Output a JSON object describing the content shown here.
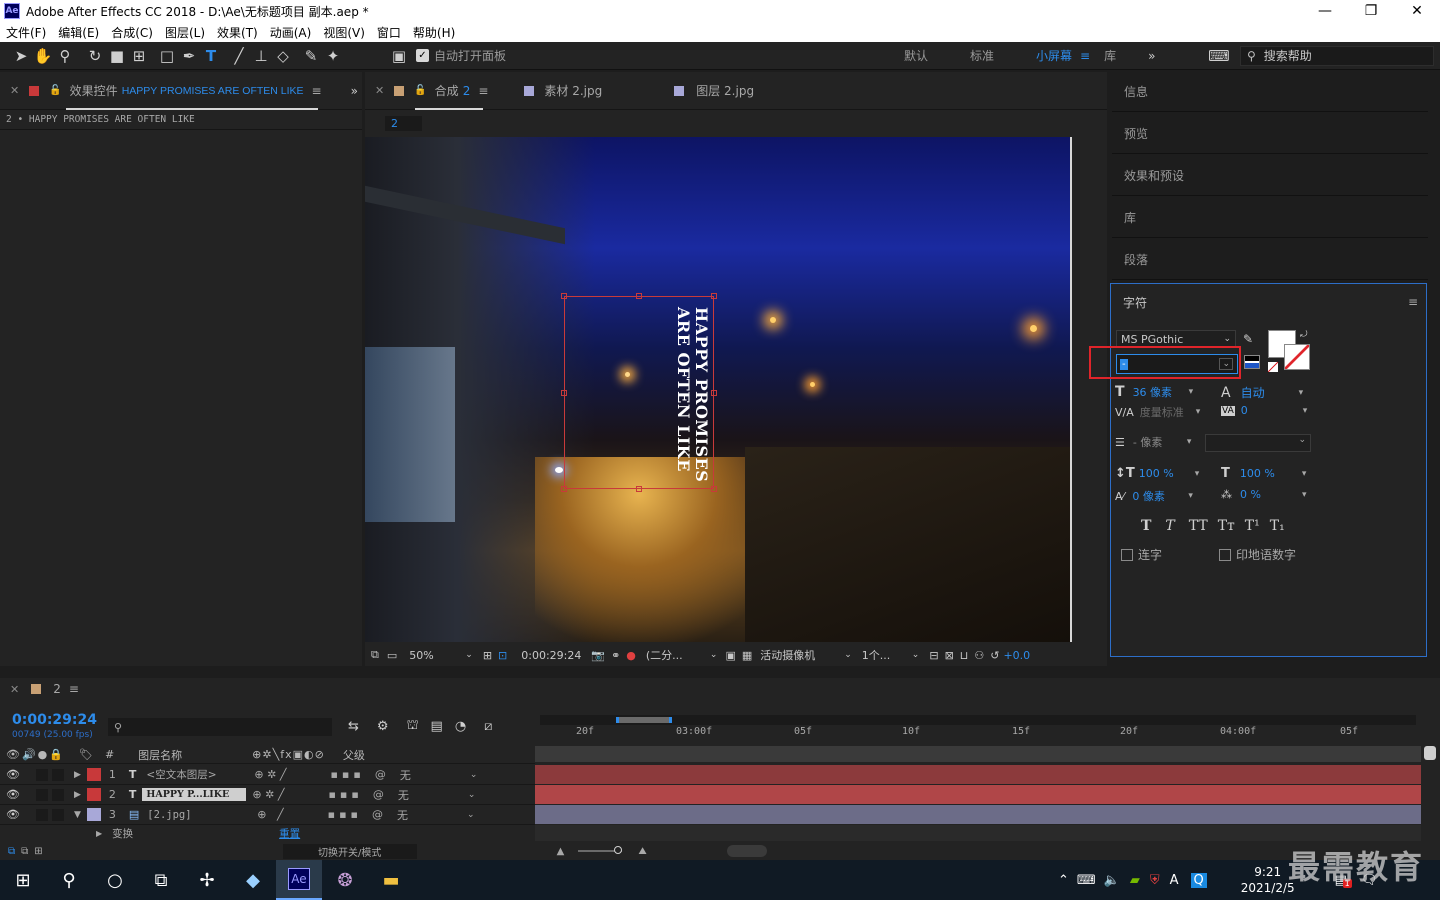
{
  "app": {
    "title": "Adobe After Effects CC 2018 - D:\\Ae\\无标题项目 副本.aep *",
    "logo": "Ae"
  },
  "window_controls": {
    "minimize": "—",
    "maximize": "❐",
    "close": "✕"
  },
  "menu": [
    "文件(F)",
    "编辑(E)",
    "合成(C)",
    "图层(L)",
    "效果(T)",
    "动画(A)",
    "视图(V)",
    "窗口",
    "帮助(H)"
  ],
  "toolbar": {
    "auto_open_label": "自动打开面板",
    "workspaces": [
      "默认",
      "标准",
      "小屏幕",
      "库"
    ],
    "active_workspace": "小屏幕",
    "search_placeholder": "搜索帮助",
    "more": "»"
  },
  "effects_panel": {
    "tab_label": "效果控件",
    "tab_layer": "HAPPY PROMISES ARE OFTEN LIKE",
    "subtitle": "2 • HAPPY PROMISES ARE OFTEN LIKE"
  },
  "comp_panel": {
    "tabs": [
      {
        "label": "合成",
        "extra": "2"
      },
      {
        "label": "素材 2.jpg"
      },
      {
        "label": "图层 2.jpg"
      }
    ],
    "breadcrumb": "2",
    "text_line1": "HAPPY PROMISES",
    "text_line2": "ARE OFTEN LIKE"
  },
  "viewer_bar": {
    "zoom": "50%",
    "timecode": "0:00:29:24",
    "resolution": "(二分...",
    "camera": "活动摄像机",
    "views": "1个...",
    "offset": "+0.0"
  },
  "right_panels": [
    "信息",
    "预览",
    "效果和预设",
    "库",
    "段落"
  ],
  "character_panel": {
    "title": "字符",
    "font": "MS PGothic",
    "style_value": "-",
    "size": "36 像素",
    "leading": "自动",
    "kerning": "度量标准",
    "tracking": "0",
    "stroke": "- 像素",
    "vscale": "100 %",
    "hscale": "100 %",
    "baseline": "0 像素",
    "tsume": "0 %",
    "styles": [
      "T",
      "T",
      "TT",
      "Tт",
      "T¹",
      "T₁"
    ],
    "ligatures": "连字",
    "hindi_digits": "印地语数字"
  },
  "timeline": {
    "tab_label": "2",
    "timecode": "0:00:29:24",
    "fps": "00749 (25.00 fps)",
    "col_layer_name": "图层名称",
    "col_parent": "父级",
    "col_num": "#",
    "layers": [
      {
        "num": "1",
        "name": "<空文本图层>",
        "parent": "无"
      },
      {
        "num": "2",
        "name": "HAPPY P...LIKE",
        "parent": "无"
      },
      {
        "num": "3",
        "name": "[2.jpg]",
        "parent": "无"
      }
    ],
    "transform_label": "变换",
    "reset_label": "重置",
    "switch_label": "切换开关/模式",
    "ruler": [
      "20f",
      "03:00f",
      "05f",
      "10f",
      "15f",
      "20f",
      "04:00f",
      "05f"
    ]
  },
  "taskbar": {
    "time": "9:21",
    "date": "2021/2/5",
    "watermark": "最需教育",
    "lang": "A",
    "badge": "1"
  },
  "colors": {
    "accent": "#2d8ceb",
    "layer_red": "#c8393a",
    "layer_lavender": "#a8a8d8",
    "highlight_red": "#e0242a"
  }
}
